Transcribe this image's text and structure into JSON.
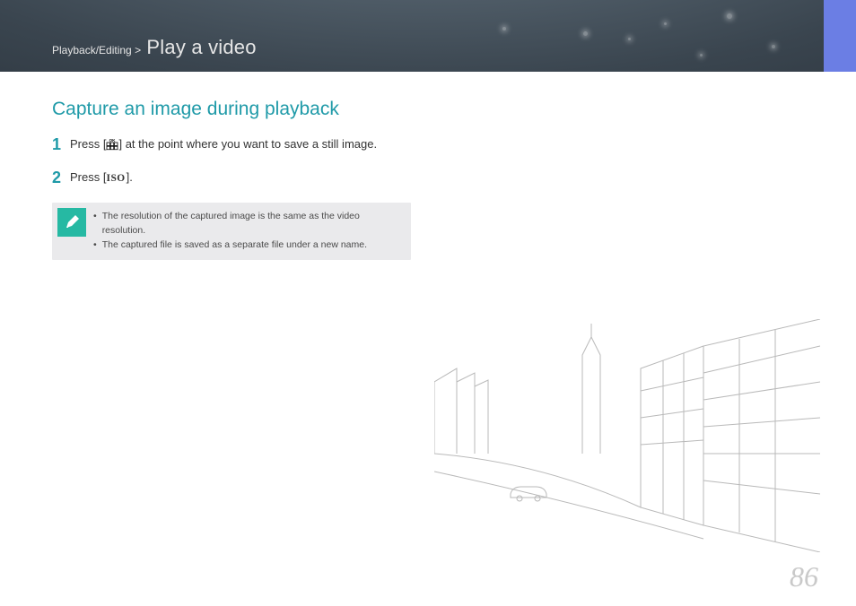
{
  "header": {
    "breadcrumb_section": "Playback/Editing",
    "breadcrumb_separator": ">",
    "breadcrumb_title": "Play a video"
  },
  "content": {
    "heading": "Capture an image during playback",
    "steps": [
      {
        "num": "1",
        "pre": "Press [",
        "icon_name": "ok-grid-icon",
        "post": "] at the point where you want to save a still image."
      },
      {
        "num": "2",
        "pre": "Press [",
        "icon_name": "iso-label",
        "icon_text": "ISO",
        "post": "]."
      }
    ],
    "notes": [
      "The resolution of the captured image is the same as the video resolution.",
      "The captured file is saved as a separate file under a new name."
    ]
  },
  "page_number": "86"
}
